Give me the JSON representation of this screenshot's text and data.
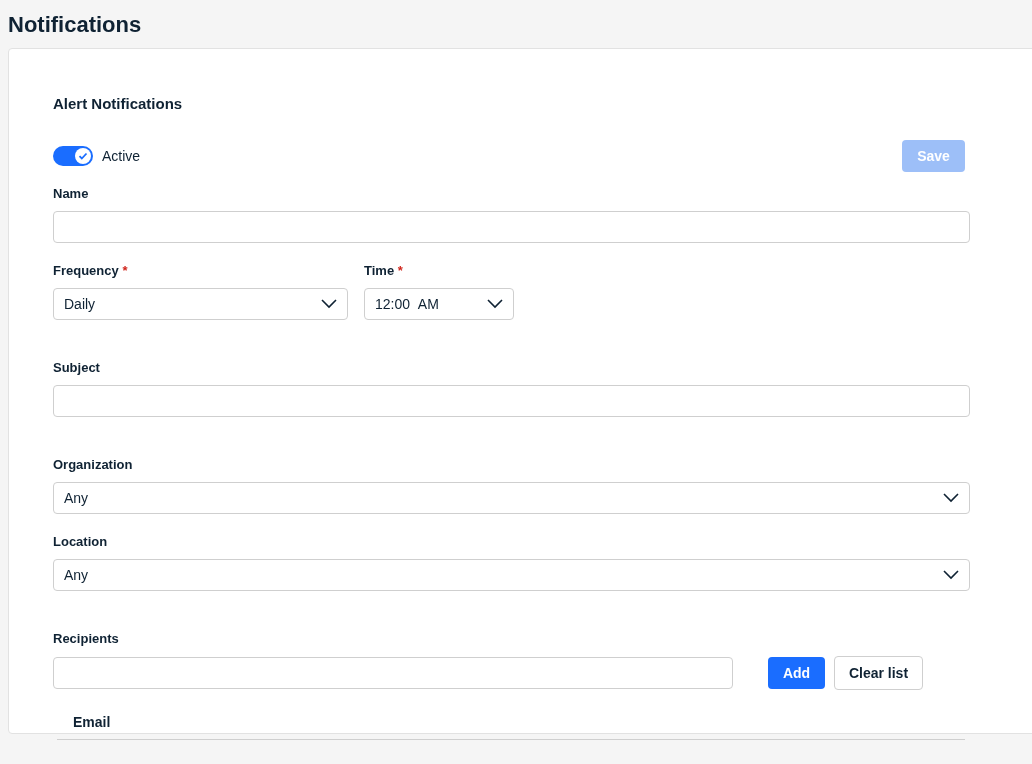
{
  "page": {
    "title": "Notifications"
  },
  "section": {
    "title": "Alert Notifications"
  },
  "toggle": {
    "label": "Active",
    "on": true
  },
  "save_button": {
    "label": "Save",
    "disabled": true
  },
  "name_field": {
    "label": "Name"
  },
  "frequency": {
    "label": "Frequency",
    "required_mark": "*",
    "value": "Daily"
  },
  "time": {
    "label": "Time",
    "required_mark": "*",
    "value": "12:00",
    "period": "AM"
  },
  "subject_field": {
    "label": "Subject"
  },
  "organization": {
    "label": "Organization",
    "value": "Any"
  },
  "location": {
    "label": "Location",
    "value": "Any"
  },
  "recipients": {
    "label": "Recipients",
    "add_button": "Add",
    "clear_button": "Clear list"
  },
  "table": {
    "columns": [
      "Email"
    ]
  }
}
